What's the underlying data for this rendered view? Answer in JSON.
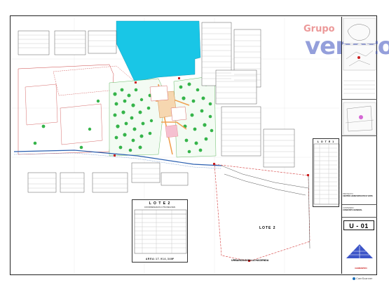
{
  "watermark": {
    "top": "Grupo",
    "main": "veneto"
  },
  "plan": {
    "lote2_label": "LOTE 2",
    "urbanizacion_label": "URBANIZACION LA HACIENDA",
    "lote2_box_title": "L O T E  2",
    "lote2_box_subtitle": "COORDENADAS UTM REGVEN",
    "lote2_box_area": "A R E A : 1 7 . 9 1 4 , 3 4  M²",
    "lote1_box_title": "L O T E  1"
  },
  "title_block": {
    "project_label": "PROYECTO:",
    "project_value": "CENTRO HORIZONTASTICO VOPE",
    "content_label": "CONTENIDO:",
    "content_value": "CONJUNTO GENERAL",
    "company": "GEMENPRO",
    "sheet_number": "U - 01"
  },
  "scanner": {
    "label": "CamScanner"
  },
  "colors": {
    "vegetation": "#35b44a",
    "vegetation_dark": "#1e8a32",
    "water": "#19c6e6",
    "accent_red": "#cc2222",
    "accent_blue": "#3d55c8",
    "road_orange": "#f0a050",
    "boundary_red": "#d43a3a"
  }
}
